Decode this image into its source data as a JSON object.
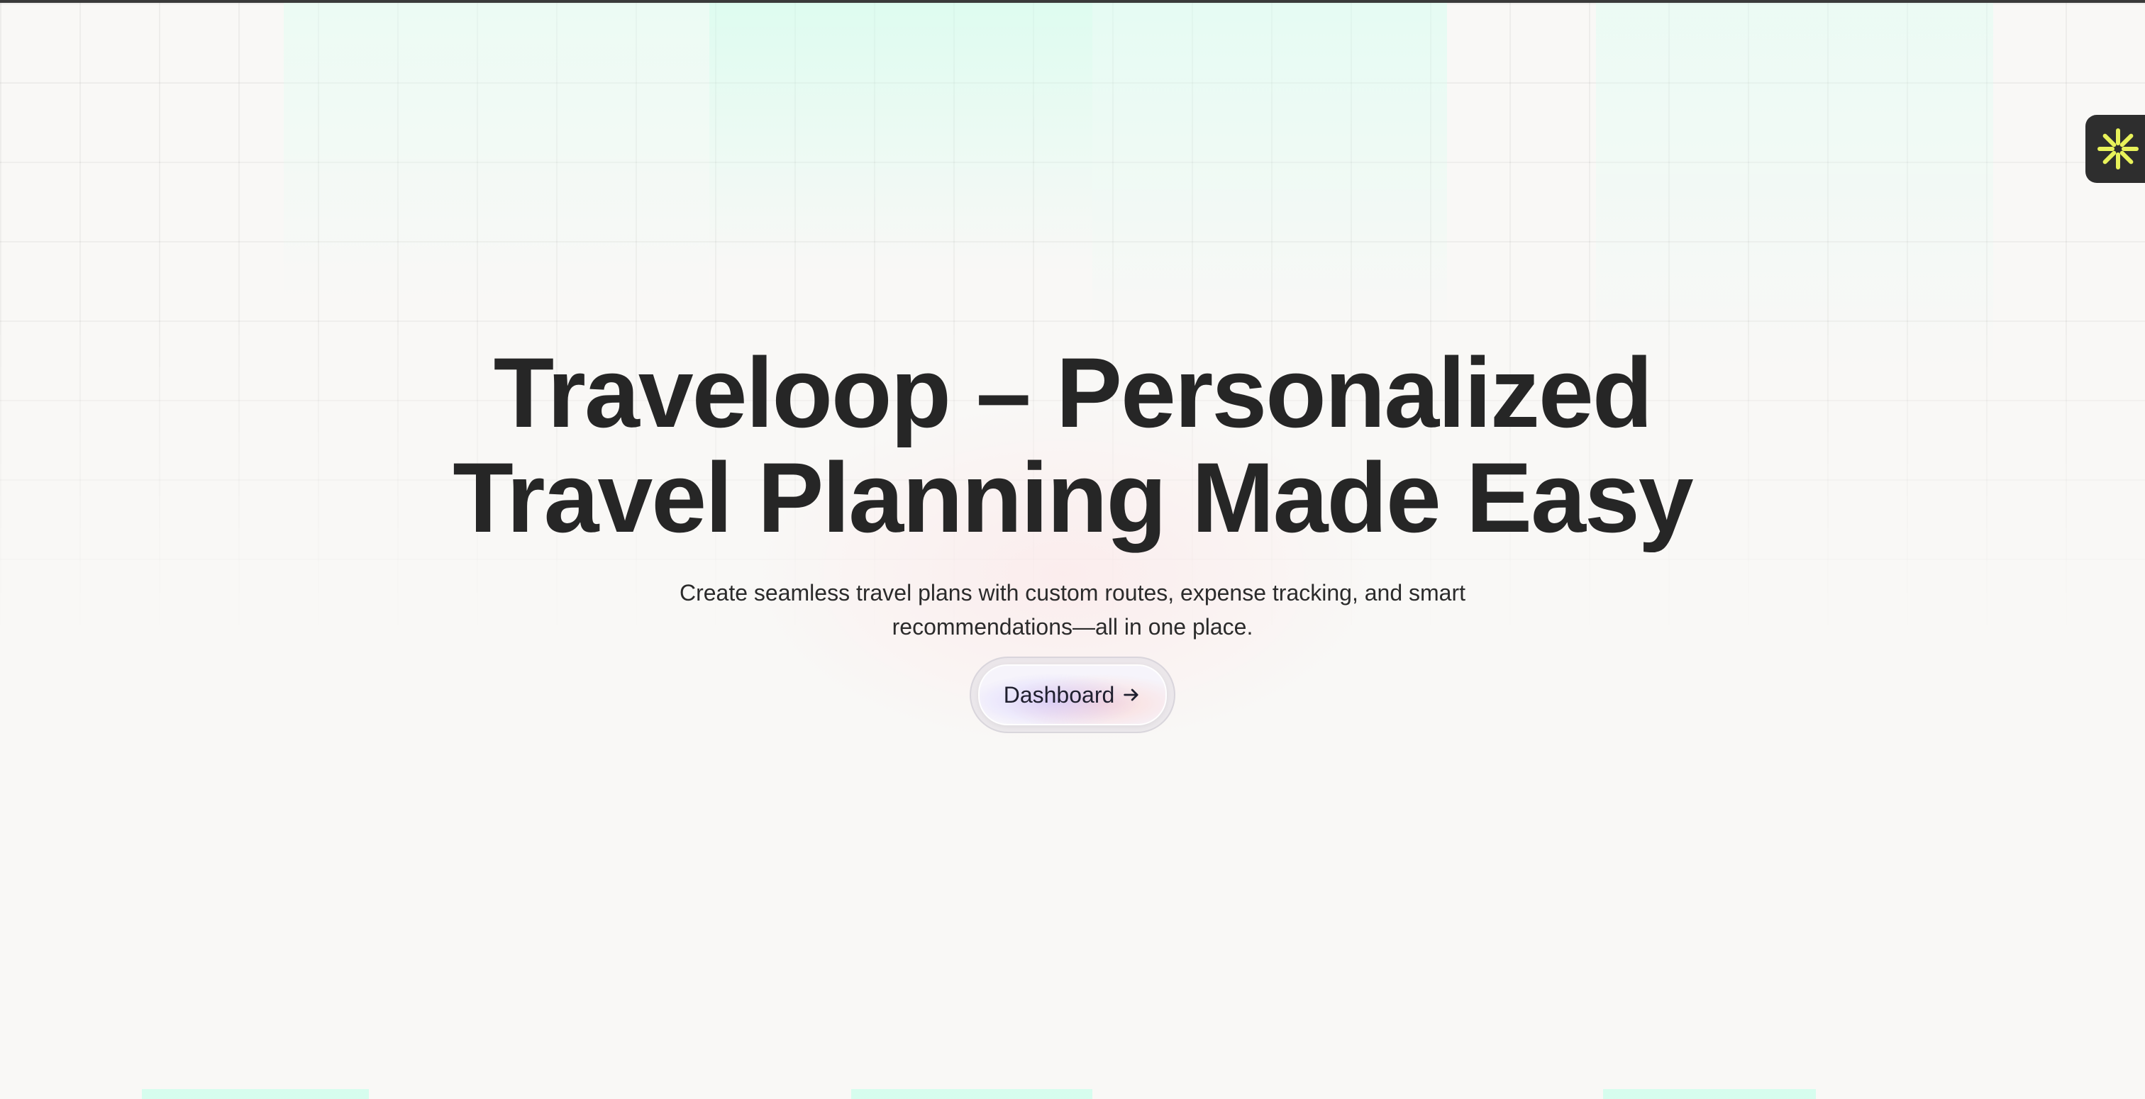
{
  "hero": {
    "title_line_1": "Traveloop – Personalized",
    "title_line_2": "Travel Planning Made Easy",
    "subtitle_line_1": "Create seamless travel plans with custom routes, expense tracking, and smart",
    "subtitle_line_2": "recommendations—all in one place.",
    "cta_label": "Dashboard",
    "cta_icon": "arrow-right-icon"
  },
  "widget": {
    "icon": "asterisk-burst-icon",
    "icon_color": "#e8f25a",
    "background_color": "#2e2e2e"
  },
  "colors": {
    "background": "#f9f8f6",
    "title_text": "#262626",
    "accent_mint": "#c8ffeb"
  }
}
